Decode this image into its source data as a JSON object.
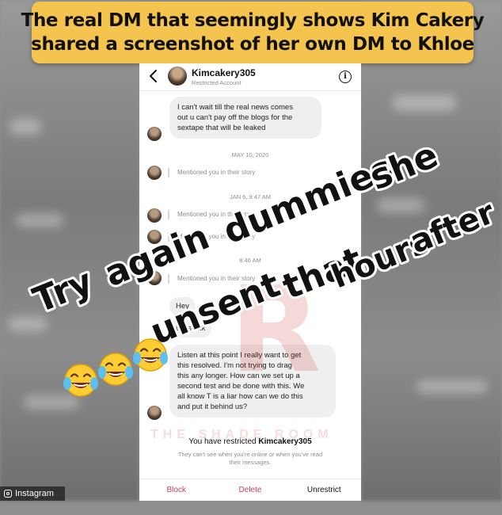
{
  "banner": {
    "line1": "The real DM that seemingly shows Kim Cakery",
    "line2": "shared a screenshot of her own DM to Khloe"
  },
  "header": {
    "username": "Kimcakery305",
    "status": "Restricted Account",
    "info_glyph": "i"
  },
  "messages": {
    "m1_line1": "I can't wait till the real news comes",
    "m1_line2": "out u can't pay off the blogs for the",
    "m1_line3": "sextape that will be leaked",
    "ts1": "MAY 10, 2020",
    "mention1": "Mentioned you in their story",
    "ts2": "JAN 6, 9:47 AM",
    "mention2": "Mentioned you in their story",
    "mention3": "Mentioned you in their story",
    "ts3": "8:46 AM",
    "mention4": "Mentioned you in their story",
    "m2": "Hey",
    "m3": "Let's talk",
    "m4_line1": "Listen at this point I really want to get",
    "m4_line2": "this resolved. I'm not trying to drag",
    "m4_line3": "this any longer. How can we set up a",
    "m4_line4": "second test and be done with this. We",
    "m4_line5": "all know T is a liar how can we do this",
    "m4_line6": "and put it behind us?"
  },
  "restrict": {
    "prefix": "You have restricted ",
    "name": "Kimcakery305",
    "sub_line1": "They can't see when you're online or when you've read",
    "sub_line2": "their messages."
  },
  "actions": {
    "block": "Block",
    "delete": "Delete",
    "unrestrict": "Unrestrict"
  },
  "overlay": {
    "line1_word1": "Try",
    "line1_word2": "again",
    "line1_word3": "dummies",
    "line1_word4": "she",
    "line2_word1": "unsent",
    "line2_word2": "that",
    "line2_word3": "hours",
    "line2_word4": "after"
  },
  "emoji": {
    "icon": "face-with-tears-of-joy-icon",
    "count": 3
  },
  "credit": {
    "label": "Instagram"
  },
  "watermark": {
    "letter": "R",
    "text": "THE SHADE ROOM"
  },
  "colors": {
    "banner": "#f5c44e",
    "action_red": "#c0435b",
    "bubble": "#efefef"
  }
}
